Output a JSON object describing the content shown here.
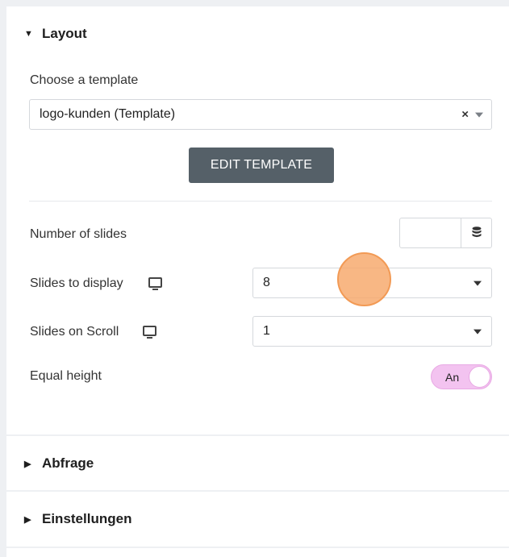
{
  "layout_section": {
    "title": "Layout",
    "choose_template_label": "Choose a template",
    "template_value": "logo-kunden (Template)",
    "clear_symbol": "×",
    "edit_button_label": "EDIT TEMPLATE",
    "number_of_slides_label": "Number of slides",
    "number_of_slides_value": "",
    "slides_to_display_label": "Slides to display",
    "slides_to_display_value": "8",
    "slides_on_scroll_label": "Slides on Scroll",
    "slides_on_scroll_value": "1",
    "equal_height_label": "Equal height",
    "equal_height_toggle_text": "An",
    "equal_height_on": true
  },
  "abfrage_section": {
    "title": "Abfrage"
  },
  "einstellungen_section": {
    "title": "Einstellungen"
  },
  "colors": {
    "button_bg": "#556068",
    "toggle_on": "#f3c3f0",
    "cursor_highlight": "#f7aa6e"
  },
  "icons": {
    "expanded_caret": "caret-down-icon",
    "collapsed_caret": "caret-right-icon",
    "responsive": "monitor-icon",
    "dynamic_tags": "database-icon"
  }
}
